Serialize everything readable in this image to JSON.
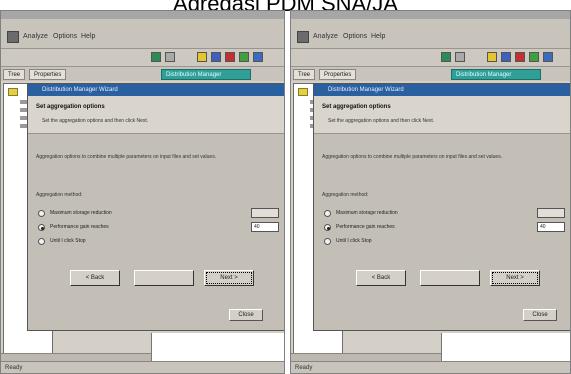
{
  "caption": "Agregasi PDM SNA/JA",
  "colors": {
    "panel": "#d4d0c8",
    "dialog": "#c3bfb7",
    "title_blue": "#2a5fa0",
    "teal_tab": "#2f9f98"
  },
  "screens": [
    {
      "menu": [
        "Analyze",
        "Options",
        "Help"
      ],
      "tabs": [
        "Tree",
        "Properties"
      ],
      "teal_tab": "Distribution Manager",
      "dialog": {
        "title": "Distribution Manager Wizard",
        "heading": "Set aggregation options",
        "sub": "Set the aggregation options and then click Next.",
        "desc": "Aggregation options to combine multiple parameters on input files and set values.",
        "group_label": "Aggregation method:",
        "options": [
          "Maximum storage reduction",
          "Performance gain reaches",
          "Until I click Stop"
        ],
        "selected": 1,
        "field_values": [
          "",
          "40"
        ],
        "buttons": {
          "back": "< Back",
          "middle": "",
          "next": "Next >"
        },
        "bottom_button": "Close"
      },
      "status": "Ready"
    },
    {
      "menu": [
        "Analyze",
        "Options",
        "Help"
      ],
      "tabs": [
        "Tree",
        "Properties"
      ],
      "teal_tab": "Distribution Manager",
      "dialog": {
        "title": "Distribution Manager Wizard",
        "heading": "Set aggregation options",
        "sub": "Set the aggregation options and then click Next.",
        "desc": "Aggregation options to combine multiple parameters on input files and set values.",
        "group_label": "Aggregation method:",
        "options": [
          "Maximum storage reduction",
          "Performance gain reaches",
          "Until I click Stop"
        ],
        "selected": 1,
        "field_values": [
          "",
          "40"
        ],
        "buttons": {
          "back": "< Back",
          "middle": "",
          "next": "Next >"
        },
        "bottom_button": "Close"
      },
      "status": "Ready"
    }
  ]
}
